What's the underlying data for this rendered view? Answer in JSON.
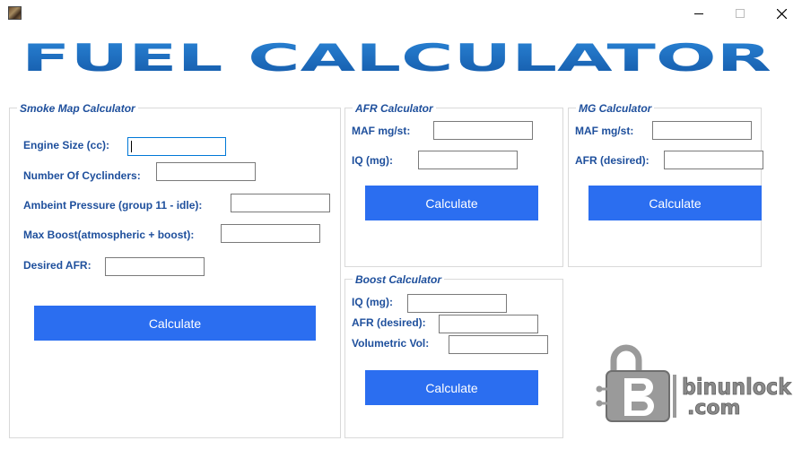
{
  "window": {
    "icon": "app-thumbnail-icon",
    "controls": [
      "minimize-icon",
      "maximize-icon",
      "close-icon"
    ]
  },
  "banner": {
    "title": "FUEL CALCULATOR",
    "color": "#1f6fc0"
  },
  "smoke_map": {
    "legend": "Smoke Map Calculator",
    "engine_size_label": "Engine Size (cc):",
    "cylinders_label": "Number Of Cyclinders:",
    "ambient_pressure_label": "Ambeint Pressure (group 11 - idle):",
    "max_boost_label": "Max Boost(atmospheric + boost):",
    "desired_afr_label": "Desired AFR:",
    "calculate_label": "Calculate"
  },
  "afr_calc": {
    "legend": "AFR Calculator",
    "maf_label": "MAF mg/st:",
    "iq_label": "IQ (mg):",
    "calculate_label": "Calculate"
  },
  "mg_calc": {
    "legend": "MG Calculator",
    "maf_label": "MAF mg/st:",
    "afr_label": "AFR (desired):",
    "calculate_label": "Calculate"
  },
  "boost_calc": {
    "legend": "Boost Calculator",
    "iq_label": "IQ (mg):",
    "afr_label": "AFR (desired):",
    "vol_label": "Volumetric Vol:",
    "calculate_label": "Calculate"
  },
  "watermark": {
    "line1": "binunlock",
    "line2": ".com",
    "icon": "padlock-b-logo-icon"
  },
  "colors": {
    "label": "#1e4f9c",
    "button": "#2b6ef0",
    "banner": "#1f6fc0",
    "watermark": "#8a8a8a"
  }
}
